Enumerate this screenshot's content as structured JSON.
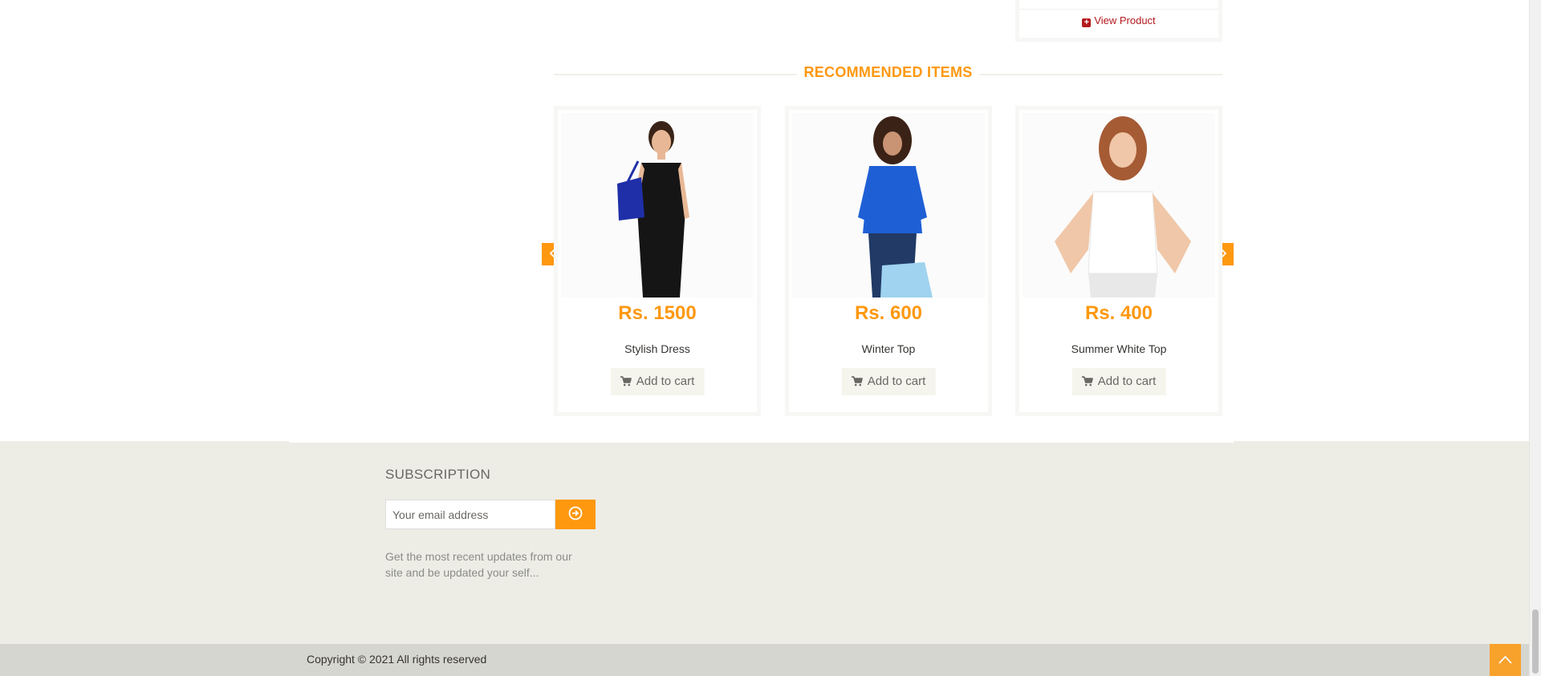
{
  "top_card": {
    "view_product_label": "View Product"
  },
  "recommended": {
    "title": "RECOMMENDED ITEMS",
    "products": [
      {
        "price": "Rs. 1500",
        "name": "Stylish Dress",
        "cart_label": "Add to cart"
      },
      {
        "price": "Rs. 600",
        "name": "Winter Top",
        "cart_label": "Add to cart"
      },
      {
        "price": "Rs. 400",
        "name": "Summer White Top",
        "cart_label": "Add to cart"
      }
    ],
    "prev_icon": "chevron-left-icon",
    "next_icon": "chevron-right-icon"
  },
  "subscription": {
    "title": "SUBSCRIPTION",
    "email_placeholder": "Your email address",
    "submit_icon": "arrow-circle-right-icon",
    "description": "Get the most recent updates from our site and be updated your self..."
  },
  "footer": {
    "copyright": "Copyright © 2021 All rights reserved"
  },
  "colors": {
    "accent": "#FE980F",
    "footer_bg": "#EDEDE6",
    "bottom_bg": "#D6D6D0",
    "link_red": "#b3191e"
  }
}
